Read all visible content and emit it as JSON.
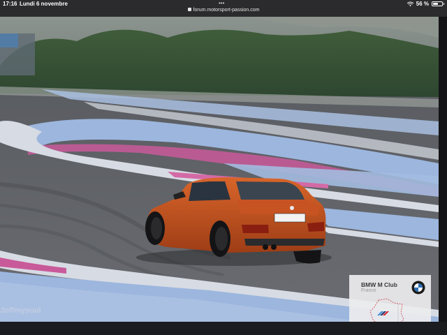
{
  "status_bar": {
    "time": "17:16",
    "date": "Lundi 6 novembre",
    "url": "forum.motorsport-passion.com",
    "battery_percent_label": "56 %",
    "battery_level": 0.56
  },
  "photo": {
    "watermark_text": "Joffmysoul",
    "badge": {
      "title": "BMW M Club",
      "subtitle": "France"
    }
  },
  "icons": [
    "lock-icon",
    "wifi-icon",
    "battery-icon",
    "more-dots-icon",
    "bmw-logo-icon"
  ],
  "colors": {
    "car": "#c4521f",
    "kerb_blue": "#9cb6de",
    "kerb_pink": "#c95a9a",
    "asphalt": "#6b6d72"
  }
}
